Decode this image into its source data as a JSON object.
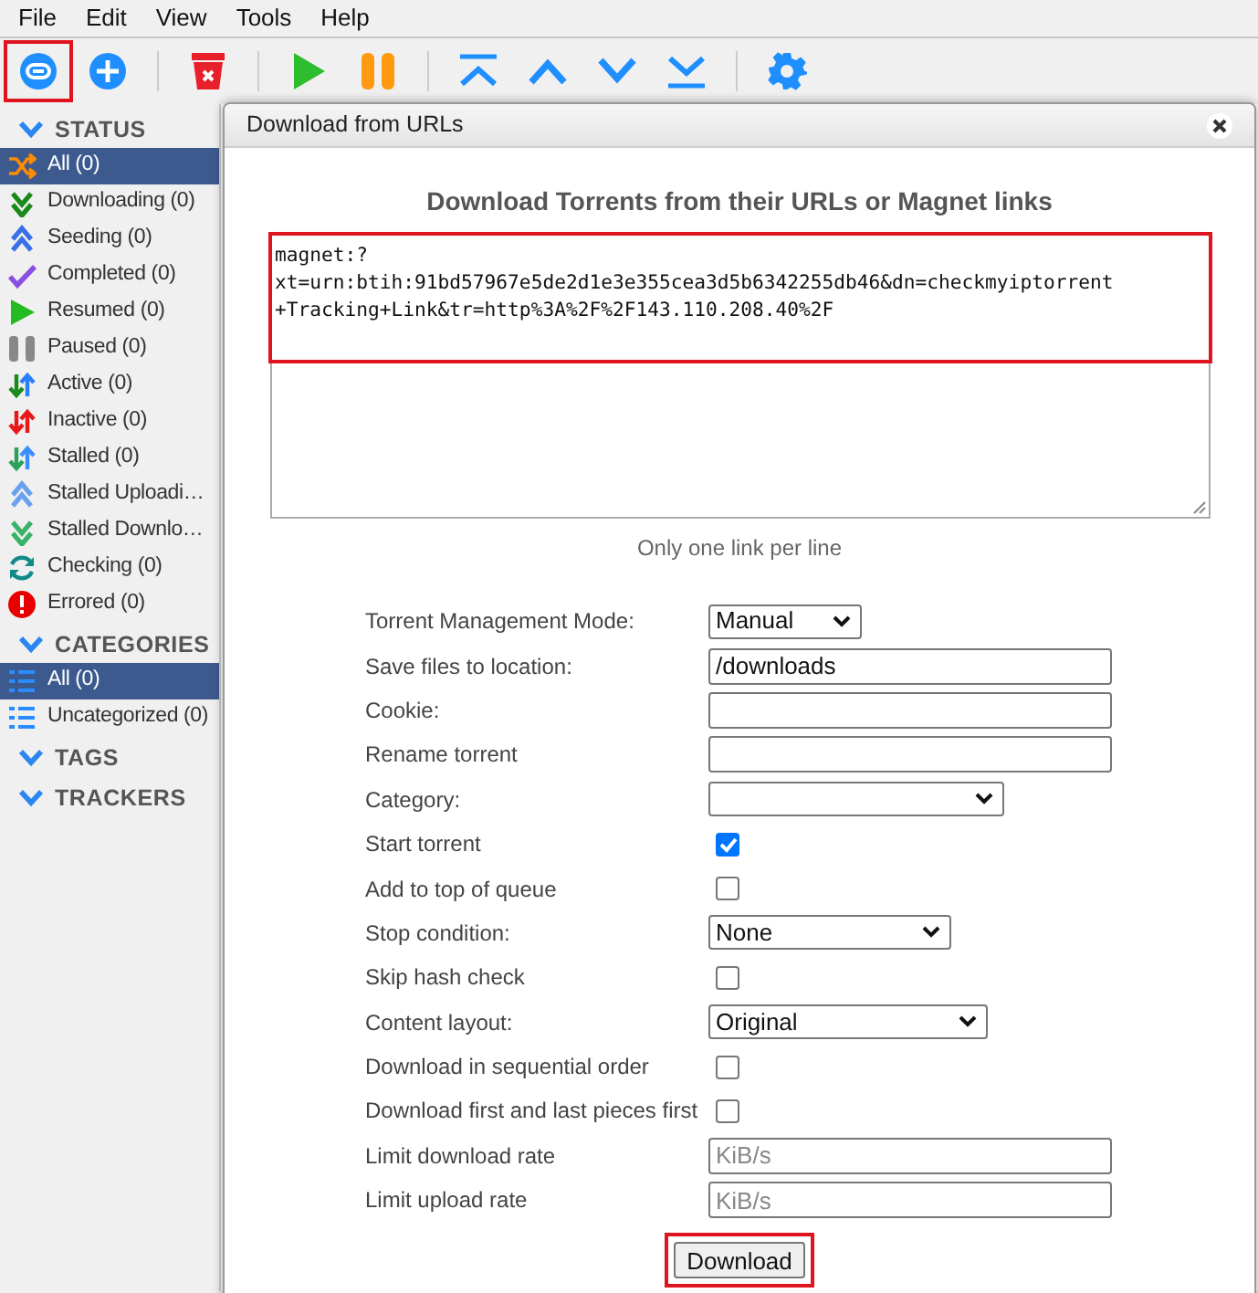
{
  "menu": [
    "File",
    "Edit",
    "View",
    "Tools",
    "Help"
  ],
  "toolbar": [
    {
      "highlighted": true
    },
    {
      "highlighted": false
    },
    {
      "highlighted": false
    },
    {
      "highlighted": false
    },
    {
      "highlighted": false
    },
    {
      "highlighted": false
    },
    {
      "highlighted": false
    },
    {
      "highlighted": false
    },
    {
      "highlighted": false
    },
    {
      "highlighted": false
    }
  ],
  "sidebar": {
    "sections": [
      {
        "title": "STATUS",
        "expanded": true,
        "items": [
          {
            "label": "All (0)",
            "selected": true
          },
          {
            "label": "Downloading (0)",
            "selected": false
          },
          {
            "label": "Seeding (0)",
            "selected": false
          },
          {
            "label": "Completed (0)",
            "selected": false
          },
          {
            "label": "Resumed (0)",
            "selected": false
          },
          {
            "label": "Paused (0)",
            "selected": false
          },
          {
            "label": "Active (0)",
            "selected": false
          },
          {
            "label": "Inactive (0)",
            "selected": false
          },
          {
            "label": "Stalled (0)",
            "selected": false
          },
          {
            "label": "Stalled Uploadi…",
            "selected": false
          },
          {
            "label": "Stalled Downlo…",
            "selected": false
          },
          {
            "label": "Checking (0)",
            "selected": false
          },
          {
            "label": "Errored (0)",
            "selected": false
          }
        ]
      },
      {
        "title": "CATEGORIES",
        "expanded": true,
        "items": [
          {
            "label": "All (0)",
            "selected": true
          },
          {
            "label": "Uncategorized (0)",
            "selected": false
          }
        ]
      },
      {
        "title": "TAGS",
        "expanded": true
      },
      {
        "title": "TRACKERS",
        "expanded": true
      }
    ]
  },
  "dialog": {
    "title": "Download from URLs",
    "heading": "Download Torrents from their URLs or Magnet links",
    "urls": {
      "value": "magnet:?\nxt=urn:btih:91bd57967e5de2d1e3e355cea3d5b6342255db46&dn=checkmyiptorrent\n+Tracking+Link&tr=http%3A%2F%2F143.110.208.40%2F",
      "highlighted": true
    },
    "hint": "Only one link per line",
    "fields": [
      {
        "label": "Torrent Management Mode:",
        "kind": "select",
        "value": "Manual"
      },
      {
        "label": "Save files to location:",
        "kind": "text",
        "value": "/downloads"
      },
      {
        "label": "Cookie:",
        "kind": "text"
      },
      {
        "label": "Rename torrent",
        "kind": "text"
      },
      {
        "label": "Category:",
        "kind": "select"
      },
      {
        "label": "Start torrent",
        "kind": "checkbox",
        "checked": true
      },
      {
        "label": "Add to top of queue",
        "kind": "checkbox",
        "checked": false
      },
      {
        "label": "Stop condition:",
        "kind": "select",
        "value": "None"
      },
      {
        "label": "Skip hash check",
        "kind": "checkbox",
        "checked": false
      },
      {
        "label": "Content layout:",
        "kind": "select",
        "value": "Original"
      },
      {
        "label": "Download in sequential order",
        "kind": "checkbox",
        "checked": false
      },
      {
        "label": "Download first and last pieces first",
        "kind": "checkbox",
        "checked": false
      },
      {
        "label": "Limit download rate",
        "kind": "text",
        "placeholder": "KiB/s"
      },
      {
        "label": "Limit upload rate",
        "kind": "text",
        "placeholder": "KiB/s"
      }
    ],
    "button": {
      "label": "Download",
      "highlighted": true
    }
  }
}
